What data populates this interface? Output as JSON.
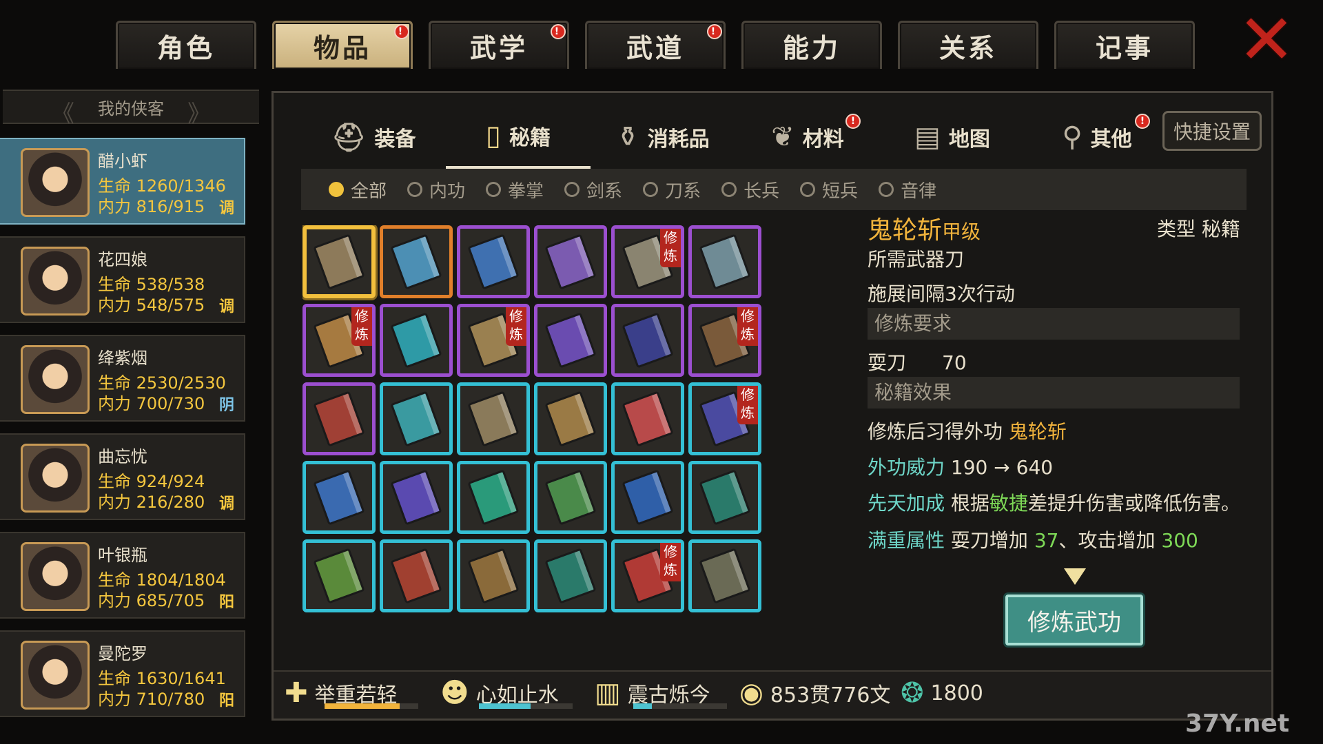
{
  "top_tabs": [
    {
      "label": "角色",
      "active": false,
      "badge": false
    },
    {
      "label": "物品",
      "active": true,
      "badge": true
    },
    {
      "label": "武学",
      "active": false,
      "badge": true
    },
    {
      "label": "武道",
      "active": false,
      "badge": true
    },
    {
      "label": "能力",
      "active": false,
      "badge": false
    },
    {
      "label": "关系",
      "active": false,
      "badge": false
    },
    {
      "label": "记事",
      "active": false,
      "badge": false
    }
  ],
  "badge_text": "!",
  "close_icon": "✕",
  "roster": {
    "title": "我的侠客",
    "characters": [
      {
        "name": "醋小虾",
        "hp": "生命 1260/1346",
        "mp": "内力 816/915",
        "tag": "调",
        "selected": true
      },
      {
        "name": "花四娘",
        "hp": "生命 538/538",
        "mp": "内力 548/575",
        "tag": "调",
        "selected": false
      },
      {
        "name": "绛紫烟",
        "hp": "生命 2530/2530",
        "mp": "内力 700/730",
        "tag": "阴",
        "selected": false
      },
      {
        "name": "曲忘忧",
        "hp": "生命 924/924",
        "mp": "内力 216/280",
        "tag": "调",
        "selected": false
      },
      {
        "name": "叶银瓶",
        "hp": "生命 1804/1804",
        "mp": "内力 685/705",
        "tag": "阳",
        "selected": false
      },
      {
        "name": "曼陀罗",
        "hp": "生命 1630/1641",
        "mp": "内力 710/780",
        "tag": "阳",
        "selected": false
      }
    ]
  },
  "category_tabs": [
    {
      "label": "装备",
      "icon": "armor-icon",
      "glyph": "⛑",
      "active": false,
      "badge": false
    },
    {
      "label": "秘籍",
      "icon": "book-icon",
      "glyph": "▯",
      "active": true,
      "badge": false
    },
    {
      "label": "消耗品",
      "icon": "potion-icon",
      "glyph": "⚱",
      "active": false,
      "badge": false
    },
    {
      "label": "材料",
      "icon": "herb-icon",
      "glyph": "❦",
      "active": false,
      "badge": true
    },
    {
      "label": "地图",
      "icon": "map-icon",
      "glyph": "▤",
      "active": false,
      "badge": false
    },
    {
      "label": "其他",
      "icon": "misc-icon",
      "glyph": "⚲",
      "active": false,
      "badge": true
    }
  ],
  "quick_settings": "快捷设置",
  "filters": [
    {
      "label": "全部",
      "on": true
    },
    {
      "label": "内功",
      "on": false
    },
    {
      "label": "拳掌",
      "on": false
    },
    {
      "label": "剑系",
      "on": false
    },
    {
      "label": "刀系",
      "on": false
    },
    {
      "label": "长兵",
      "on": false
    },
    {
      "label": "短兵",
      "on": false
    },
    {
      "label": "音律",
      "on": false
    }
  ],
  "xiu_lian_tag": "修炼",
  "books": [
    {
      "rarity": "orange",
      "color": "#8d7a5a",
      "xiu": false,
      "selected": true
    },
    {
      "rarity": "orange",
      "color": "#4c8fb4",
      "xiu": false
    },
    {
      "rarity": "purple",
      "color": "#3f70b0",
      "xiu": false
    },
    {
      "rarity": "purple",
      "color": "#7b5bb0",
      "xiu": false
    },
    {
      "rarity": "purple",
      "color": "#8a8470",
      "xiu": true
    },
    {
      "rarity": "purple",
      "color": "#6f8b95",
      "xiu": false
    },
    {
      "rarity": "purple",
      "color": "#a67a40",
      "xiu": true
    },
    {
      "rarity": "purple",
      "color": "#2e9aa6",
      "xiu": false
    },
    {
      "rarity": "purple",
      "color": "#9a8050",
      "xiu": true
    },
    {
      "rarity": "purple",
      "color": "#6a4cb0",
      "xiu": false
    },
    {
      "rarity": "purple",
      "color": "#3a3f8a",
      "xiu": false
    },
    {
      "rarity": "purple",
      "color": "#7a5a3a",
      "xiu": true
    },
    {
      "rarity": "purple",
      "color": "#a04035",
      "xiu": false
    },
    {
      "rarity": "cyan",
      "color": "#3a9aa0",
      "xiu": false
    },
    {
      "rarity": "cyan",
      "color": "#8a7a5a",
      "xiu": false
    },
    {
      "rarity": "cyan",
      "color": "#9a7a45",
      "xiu": false
    },
    {
      "rarity": "cyan",
      "color": "#b84a4a",
      "xiu": false
    },
    {
      "rarity": "cyan",
      "color": "#4a4aa0",
      "xiu": true
    },
    {
      "rarity": "cyan",
      "color": "#3a6ab0",
      "xiu": false
    },
    {
      "rarity": "cyan",
      "color": "#5a4ab0",
      "xiu": false
    },
    {
      "rarity": "cyan",
      "color": "#2a9a7a",
      "xiu": false
    },
    {
      "rarity": "cyan",
      "color": "#4a8a4a",
      "xiu": false
    },
    {
      "rarity": "cyan",
      "color": "#2f5fa8",
      "xiu": false
    },
    {
      "rarity": "cyan",
      "color": "#2a7a6a",
      "xiu": false
    },
    {
      "rarity": "cyan",
      "color": "#5a8a3a",
      "xiu": false
    },
    {
      "rarity": "cyan",
      "color": "#a04030",
      "xiu": false
    },
    {
      "rarity": "cyan",
      "color": "#8a6a3a",
      "xiu": false
    },
    {
      "rarity": "cyan",
      "color": "#2a7a6a",
      "xiu": false
    },
    {
      "rarity": "cyan",
      "color": "#b03a35",
      "xiu": true
    },
    {
      "rarity": "cyan",
      "color": "#6a6a55",
      "xiu": false
    }
  ],
  "detail": {
    "name": "鬼轮斩",
    "grade": "甲级",
    "type_label": "类型",
    "type_value": "秘籍",
    "weapon": "所需武器刀",
    "interval": "施展间隔3次行动",
    "req_title": "修炼要求",
    "req_skill": "耍刀",
    "req_value": "70",
    "effect_title": "秘籍效果",
    "learn_prefix": "修炼后习得外功",
    "learn_skill": "鬼轮斩",
    "power_label": "外功威力",
    "power_value": "190 → 640",
    "innate_label": "先天加成",
    "innate_pre": "根据",
    "innate_attr": "敏捷",
    "innate_post": "差提升伤害或降低伤害。",
    "full_label": "满重属性",
    "full_pre": "耍刀增加",
    "full_val1": "37",
    "full_mid": "、攻击增加",
    "full_val2": "300",
    "train_button": "修炼武功"
  },
  "status": {
    "buff1": {
      "icon": "strength-icon",
      "glyph": "✚",
      "label": "举重若轻",
      "level": 0.8,
      "color": "#f1b33c"
    },
    "buff2": {
      "icon": "calm-face-icon",
      "glyph": "☻",
      "label": "心如止水",
      "level": 0.55,
      "color": "#4ec3d0"
    },
    "buff3": {
      "icon": "drum-icon",
      "glyph": "▥",
      "label": "震古烁今",
      "level": 0.2,
      "color": "#4ec3d0"
    },
    "coins": {
      "icon": "coin-icon",
      "glyph": "◉",
      "value": "853贯776文"
    },
    "jade": {
      "icon": "jade-icon",
      "glyph": "❂",
      "value": "1800"
    }
  },
  "watermark": "37Y.net"
}
